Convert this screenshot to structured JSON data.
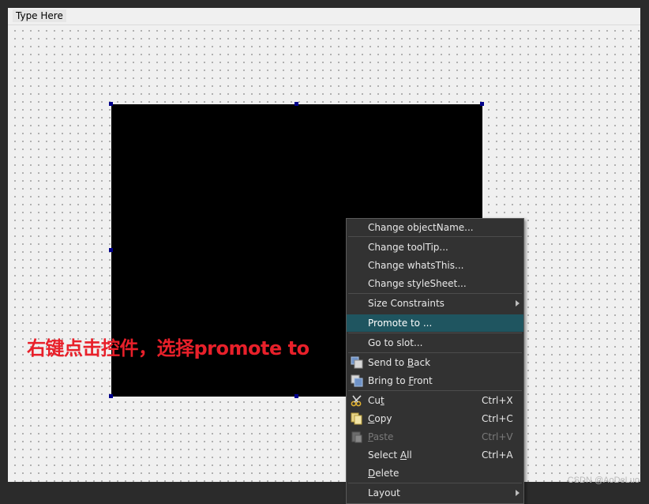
{
  "menubar": {
    "type_here": "Type Here"
  },
  "annotation": "右键点击控件，选择promote to",
  "watermark": "CSDN @AoDeLuo",
  "context_menu": {
    "items": [
      {
        "label": "Change objectName...",
        "shortcut": ""
      },
      {
        "label": "Change toolTip...",
        "shortcut": ""
      },
      {
        "label": "Change whatsThis...",
        "shortcut": ""
      },
      {
        "label": "Change styleSheet...",
        "shortcut": ""
      },
      {
        "label": "Size Constraints",
        "shortcut": ""
      },
      {
        "label": "Promote to ...",
        "shortcut": ""
      },
      {
        "label": "Go to slot...",
        "shortcut": ""
      },
      {
        "label_pre": "Send to ",
        "label_u": "B",
        "label_post": "ack"
      },
      {
        "label_pre": "Bring to ",
        "label_u": "F",
        "label_post": "ront"
      },
      {
        "label_pre": "Cu",
        "label_u": "t",
        "label_post": "",
        "shortcut": "Ctrl+X"
      },
      {
        "label_pre": "",
        "label_u": "C",
        "label_post": "opy",
        "shortcut": "Ctrl+C"
      },
      {
        "label_pre": "",
        "label_u": "P",
        "label_post": "aste",
        "shortcut": "Ctrl+V"
      },
      {
        "label_pre": "Select ",
        "label_u": "A",
        "label_post": "ll",
        "shortcut": "Ctrl+A"
      },
      {
        "label_pre": "",
        "label_u": "D",
        "label_post": "elete",
        "shortcut": ""
      },
      {
        "label": "Layout",
        "shortcut": ""
      }
    ],
    "highlight_color": "#1f5560"
  }
}
